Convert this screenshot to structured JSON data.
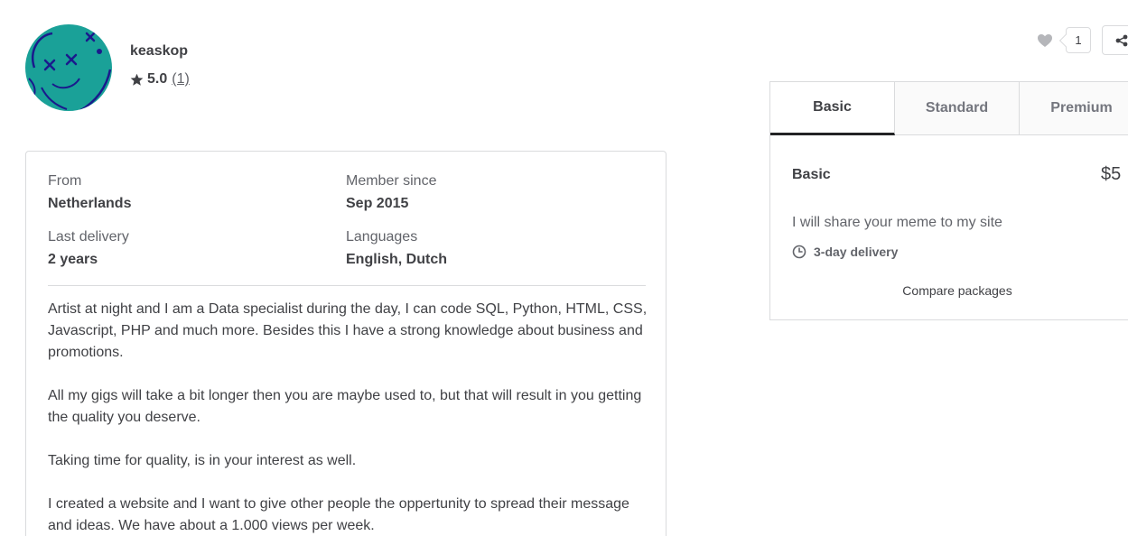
{
  "seller": {
    "name": "keaskop",
    "rating": "5.0",
    "review_count": "(1)"
  },
  "about": {
    "from_label": "From",
    "from_value": "Netherlands",
    "member_label": "Member since",
    "member_value": "Sep 2015",
    "delivery_label": "Last delivery",
    "delivery_value": "2 years",
    "languages_label": "Languages",
    "languages_value": "English, Dutch",
    "paragraphs": [
      "Artist at night and I am a Data specialist during the day, I can code SQL, Python, HTML, CSS, Javascript, PHP and much more. Besides this I have a strong knowledge about business and promotions.",
      "All my gigs will take a bit longer then you are maybe used to, but that will result in you getting the quality you deserve.",
      "Taking time for quality, is in your interest as well.",
      "I created a website and I want to give other people the oppertunity to spread their message and ideas. We have about a 1.000 views per week."
    ]
  },
  "actions": {
    "like_count": "1"
  },
  "packages": {
    "tabs": [
      "Basic",
      "Standard",
      "Premium"
    ],
    "active_tab": "Basic",
    "name": "Basic",
    "price": "$5",
    "description": "I will share your meme to my site",
    "delivery": "3-day delivery",
    "compare_label": "Compare packages"
  },
  "colors": {
    "avatar_bg": "#1aa198",
    "avatar_ink": "#1a1a8c",
    "text_primary": "#404145",
    "text_secondary": "#62646a",
    "border": "#dadbdd"
  }
}
